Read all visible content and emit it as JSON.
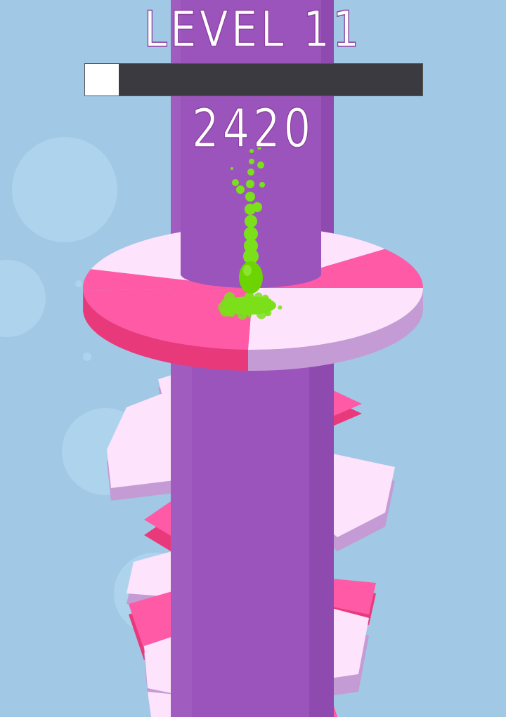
{
  "hud": {
    "level_label": "LEVEL 11",
    "progress_fraction": 0.1,
    "score": "2420"
  },
  "colors": {
    "background": "#a1c8e5",
    "tower": "#9b54bb",
    "tower_shadow": "#8240a3",
    "safe_top": "#fde3fb",
    "safe_side": "#c49bd4",
    "danger_top": "#ff5aa6",
    "danger_side": "#e83a7a",
    "ball": "#6cd400",
    "splash": "#7be01a",
    "bubble": "#b9dcf2"
  },
  "icons": {
    "ball": "bouncing-ball-icon",
    "splash": "paint-splash-icon"
  }
}
